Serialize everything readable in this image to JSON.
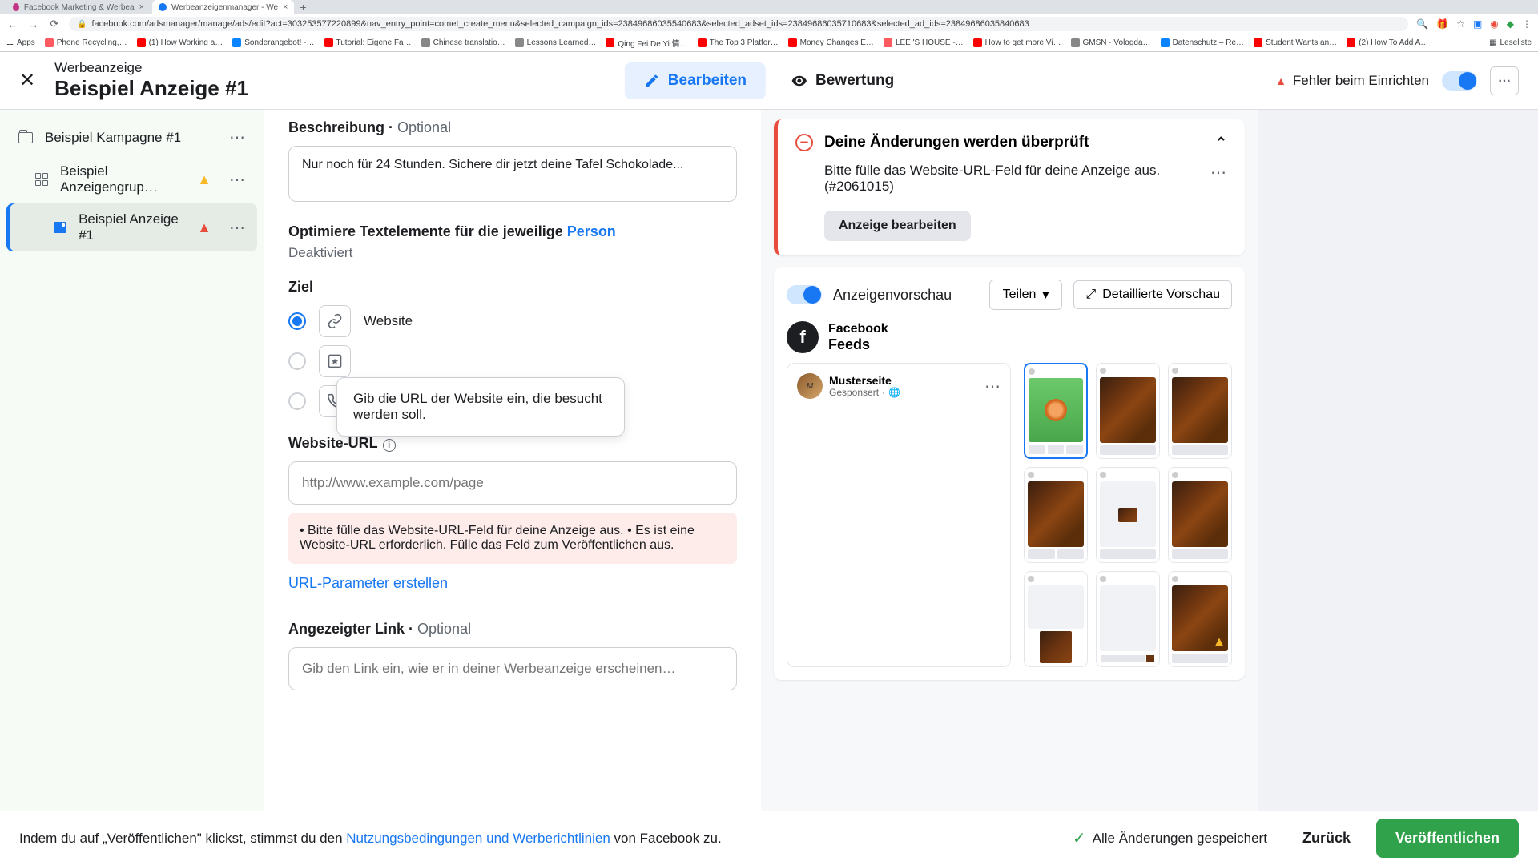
{
  "browser": {
    "tabs": [
      {
        "label": "Facebook Marketing & Werbea"
      },
      {
        "label": "Werbeanzeigenmanager - We"
      }
    ],
    "url": "facebook.com/adsmanager/manage/ads/edit?act=303253577220899&nav_entry_point=comet_create_menu&selected_campaign_ids=23849686035540683&selected_adset_ids=23849686035710683&selected_ad_ids=23849686035840683",
    "bookmarks": [
      "Apps",
      "Phone Recycling,…",
      "(1) How Working a…",
      "Sonderangebot! -…",
      "Tutorial: Eigene Fa…",
      "Chinese translatio…",
      "Lessons Learned…",
      "Qing Fei De Yi 情…",
      "The Top 3 Platfor…",
      "Money Changes E…",
      "LEE 'S HOUSE -…",
      "How to get more Vi…",
      "GMSN · Vologda…",
      "Datenschutz – Re…",
      "Student Wants an…",
      "(2) How To Add A…"
    ],
    "reading_list": "Leseliste"
  },
  "header": {
    "category": "Werbeanzeige",
    "title": "Beispiel Anzeige #1",
    "tab_edit": "Bearbeiten",
    "tab_review": "Bewertung",
    "error_status": "Fehler beim Einrichten"
  },
  "sidebar": {
    "campaign": "Beispiel Kampagne #1",
    "adset": "Beispiel Anzeigengrup…",
    "ad": "Beispiel Anzeige #1"
  },
  "form": {
    "description_label": "Beschreibung",
    "optional": "Optional",
    "description_value": "Nur noch für 24 Stunden. Sichere dir jetzt deine Tafel Schokolade...",
    "optimize_label": "Optimiere Textelemente für die jeweilige ",
    "optimize_link": "Person",
    "deactivated": "Deaktiviert",
    "ziel_label": "Ziel",
    "radio_website": "Website",
    "tooltip": "Gib die URL der Website ein, die besucht werden soll.",
    "url_label": "Website-URL",
    "url_placeholder": "http://www.example.com/page",
    "url_error": "• Bitte fülle das Website-URL-Feld für deine Anzeige aus. • Es ist eine Website-URL erforderlich. Fülle das Feld zum Veröffentlichen aus.",
    "url_params": "URL-Parameter erstellen",
    "display_link_label": "Angezeigter Link",
    "display_link_placeholder": "Gib den Link ein, wie er in deiner Werbeanzeige erscheinen…"
  },
  "review": {
    "title": "Deine Änderungen werden überprüft",
    "body": "Bitte fülle das Website-URL-Feld für deine Anzeige aus. (#2061015)",
    "edit_btn": "Anzeige bearbeiten"
  },
  "preview": {
    "title": "Anzeigenvorschau",
    "share": "Teilen",
    "detail": "Detaillierte Vorschau",
    "platform": "Facebook",
    "placement": "Feeds",
    "page_name": "Musterseite",
    "sponsored": "Gesponsert"
  },
  "footer": {
    "text_pre": "Indem du auf „Veröffentlichen\" klickst, stimmst du den ",
    "link": "Nutzungsbedingungen und Werberichtlinien",
    "text_post": " von Facebook zu.",
    "saved": "Alle Änderungen gespeichert",
    "back": "Zurück",
    "publish": "Veröffentlichen"
  }
}
